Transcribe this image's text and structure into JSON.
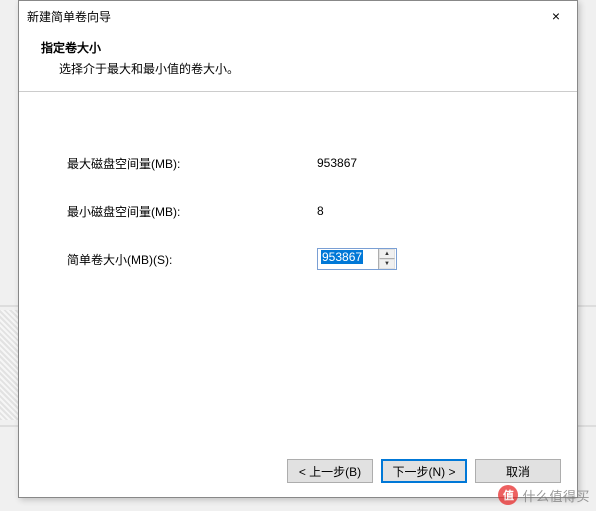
{
  "dialog": {
    "title": "新建简单卷向导",
    "close_icon": "×"
  },
  "header": {
    "heading": "指定卷大小",
    "sub": "选择介于最大和最小值的卷大小。"
  },
  "fields": {
    "max_label": "最大磁盘空间量(MB):",
    "max_value": "953867",
    "min_label": "最小磁盘空间量(MB):",
    "min_value": "8",
    "size_label": "简单卷大小(MB)(S):",
    "size_value": "953867"
  },
  "buttons": {
    "back": "< 上一步(B)",
    "next": "下一步(N) >",
    "cancel": "取消"
  },
  "watermark": {
    "badge": "值",
    "text": "什么值得买"
  }
}
